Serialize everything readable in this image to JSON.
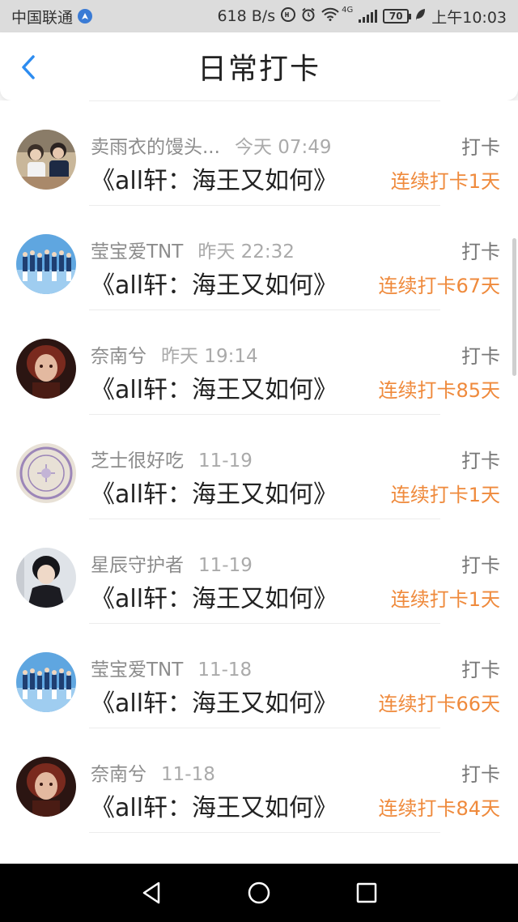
{
  "status_bar": {
    "carrier": "中国联通",
    "speed": "618 B/s",
    "network": "4G",
    "battery": "70",
    "time": "上午10:03"
  },
  "header": {
    "title": "日常打卡"
  },
  "rows": [
    {
      "name": "卖雨衣的馒头...",
      "time": "今天 07:49",
      "book": "《all轩：海王又如何》",
      "action": "打卡",
      "streak": "连续打卡1天",
      "avatar": "photo-two-people"
    },
    {
      "name": "莹宝爱TNT",
      "time": "昨天 22:32",
      "book": "《all轩：海王又如何》",
      "action": "打卡",
      "streak": "连续打卡67天",
      "avatar": "group-photo-blue"
    },
    {
      "name": "奈南兮",
      "time": "昨天 19:14",
      "book": "《all轩：海王又如何》",
      "action": "打卡",
      "streak": "连续打卡85天",
      "avatar": "portrait-dark-red"
    },
    {
      "name": "芝士很好吃",
      "time": "11-19",
      "book": "《all轩：海王又如何》",
      "action": "打卡",
      "streak": "连续打卡1天",
      "avatar": "stamp-badge"
    },
    {
      "name": "星辰守护者",
      "time": "11-19",
      "book": "《all轩：海王又如何》",
      "action": "打卡",
      "streak": "连续打卡1天",
      "avatar": "portrait-boy"
    },
    {
      "name": "莹宝爱TNT",
      "time": "11-18",
      "book": "《all轩：海王又如何》",
      "action": "打卡",
      "streak": "连续打卡66天",
      "avatar": "group-photo-blue"
    },
    {
      "name": "奈南兮",
      "time": "11-18",
      "book": "《all轩：海王又如何》",
      "action": "打卡",
      "streak": "连续打卡84天",
      "avatar": "portrait-dark-red"
    }
  ],
  "colors": {
    "accent": "#ef8a3c",
    "back_arrow": "#2d8cf0"
  },
  "nav_icons": [
    "back-triangle-icon",
    "home-circle-icon",
    "recents-square-icon"
  ]
}
